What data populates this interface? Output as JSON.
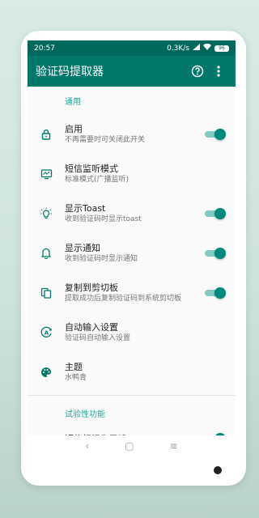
{
  "status_bar": {
    "time": "20:57",
    "network_speed": "0.3K/s",
    "battery": "96"
  },
  "app_bar": {
    "title": "验证码提取器",
    "help_icon": "help-circle-icon",
    "more_icon": "more-vert-icon"
  },
  "sections": {
    "general": "通用",
    "experimental": "试验性功能"
  },
  "rows": [
    {
      "title": "启用",
      "subtitle": "不再需要时可关闭此开关",
      "icon": "lock-icon",
      "switch": true
    },
    {
      "title": "短信监听模式",
      "subtitle": "标准模式(广播监听)",
      "icon": "monitor-icon",
      "switch": false
    },
    {
      "title": "显示Toast",
      "subtitle": "收到验证码时显示toast",
      "icon": "lightbulb-icon",
      "switch": true
    },
    {
      "title": "显示通知",
      "subtitle": "收到验证码时显示通知",
      "icon": "bell-icon",
      "switch": true
    },
    {
      "title": "复制到剪切板",
      "subtitle": "提取成功后复制验证码到系统剪切板",
      "icon": "copy-icon",
      "switch": true
    },
    {
      "title": "自动输入设置",
      "subtitle": "验证码自动输入设置",
      "icon": "auto-input-icon",
      "switch": false
    },
    {
      "title": "主题",
      "subtitle": "水鸭青",
      "icon": "palette-icon",
      "switch": false
    },
    {
      "title": "短信标记为已读",
      "subtitle": "",
      "icon": "check-icon",
      "switch": true
    }
  ],
  "nav_bar": {
    "back": "‹",
    "home": "▢",
    "menu": "≡"
  },
  "colors": {
    "primary": "#00796b",
    "primary_dark": "#00695c",
    "accent": "#26a69a"
  }
}
